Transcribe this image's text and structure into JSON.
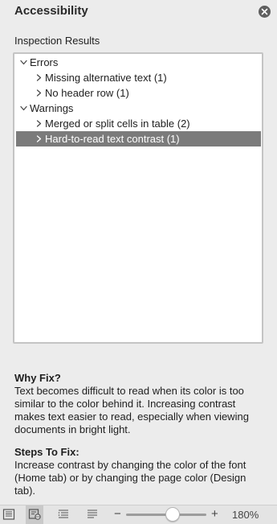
{
  "pane": {
    "title": "Accessibility",
    "section_label": "Inspection Results"
  },
  "tree": [
    {
      "label": "Errors",
      "level": 0,
      "expanded": true,
      "selected": false
    },
    {
      "label": "Missing alternative text (1)",
      "level": 1,
      "expanded": false,
      "selected": false
    },
    {
      "label": "No header row (1)",
      "level": 1,
      "expanded": false,
      "selected": false
    },
    {
      "label": "Warnings",
      "level": 0,
      "expanded": true,
      "selected": false
    },
    {
      "label": "Merged or split cells in table (2)",
      "level": 1,
      "expanded": false,
      "selected": false
    },
    {
      "label": "Hard-to-read text contrast (1)",
      "level": 1,
      "expanded": false,
      "selected": true
    }
  ],
  "info": {
    "why_heading": "Why Fix?",
    "why_body": "Text becomes difficult to read when its color is too similar to the color behind it. Increasing contrast makes text easier to read, especially when viewing documents in bright light.",
    "steps_heading": "Steps To Fix:",
    "steps_body": "Increase contrast by changing the color of the font (Home tab) or by changing the page color (Design tab)."
  },
  "status_bar": {
    "active_view": "web-layout",
    "zoom_minus": "−",
    "zoom_plus": "+",
    "zoom_percent": "180%",
    "zoom_level_fraction": 0.58
  },
  "colors": {
    "selection": "#7b7b7b",
    "pane_background": "#ececec"
  }
}
